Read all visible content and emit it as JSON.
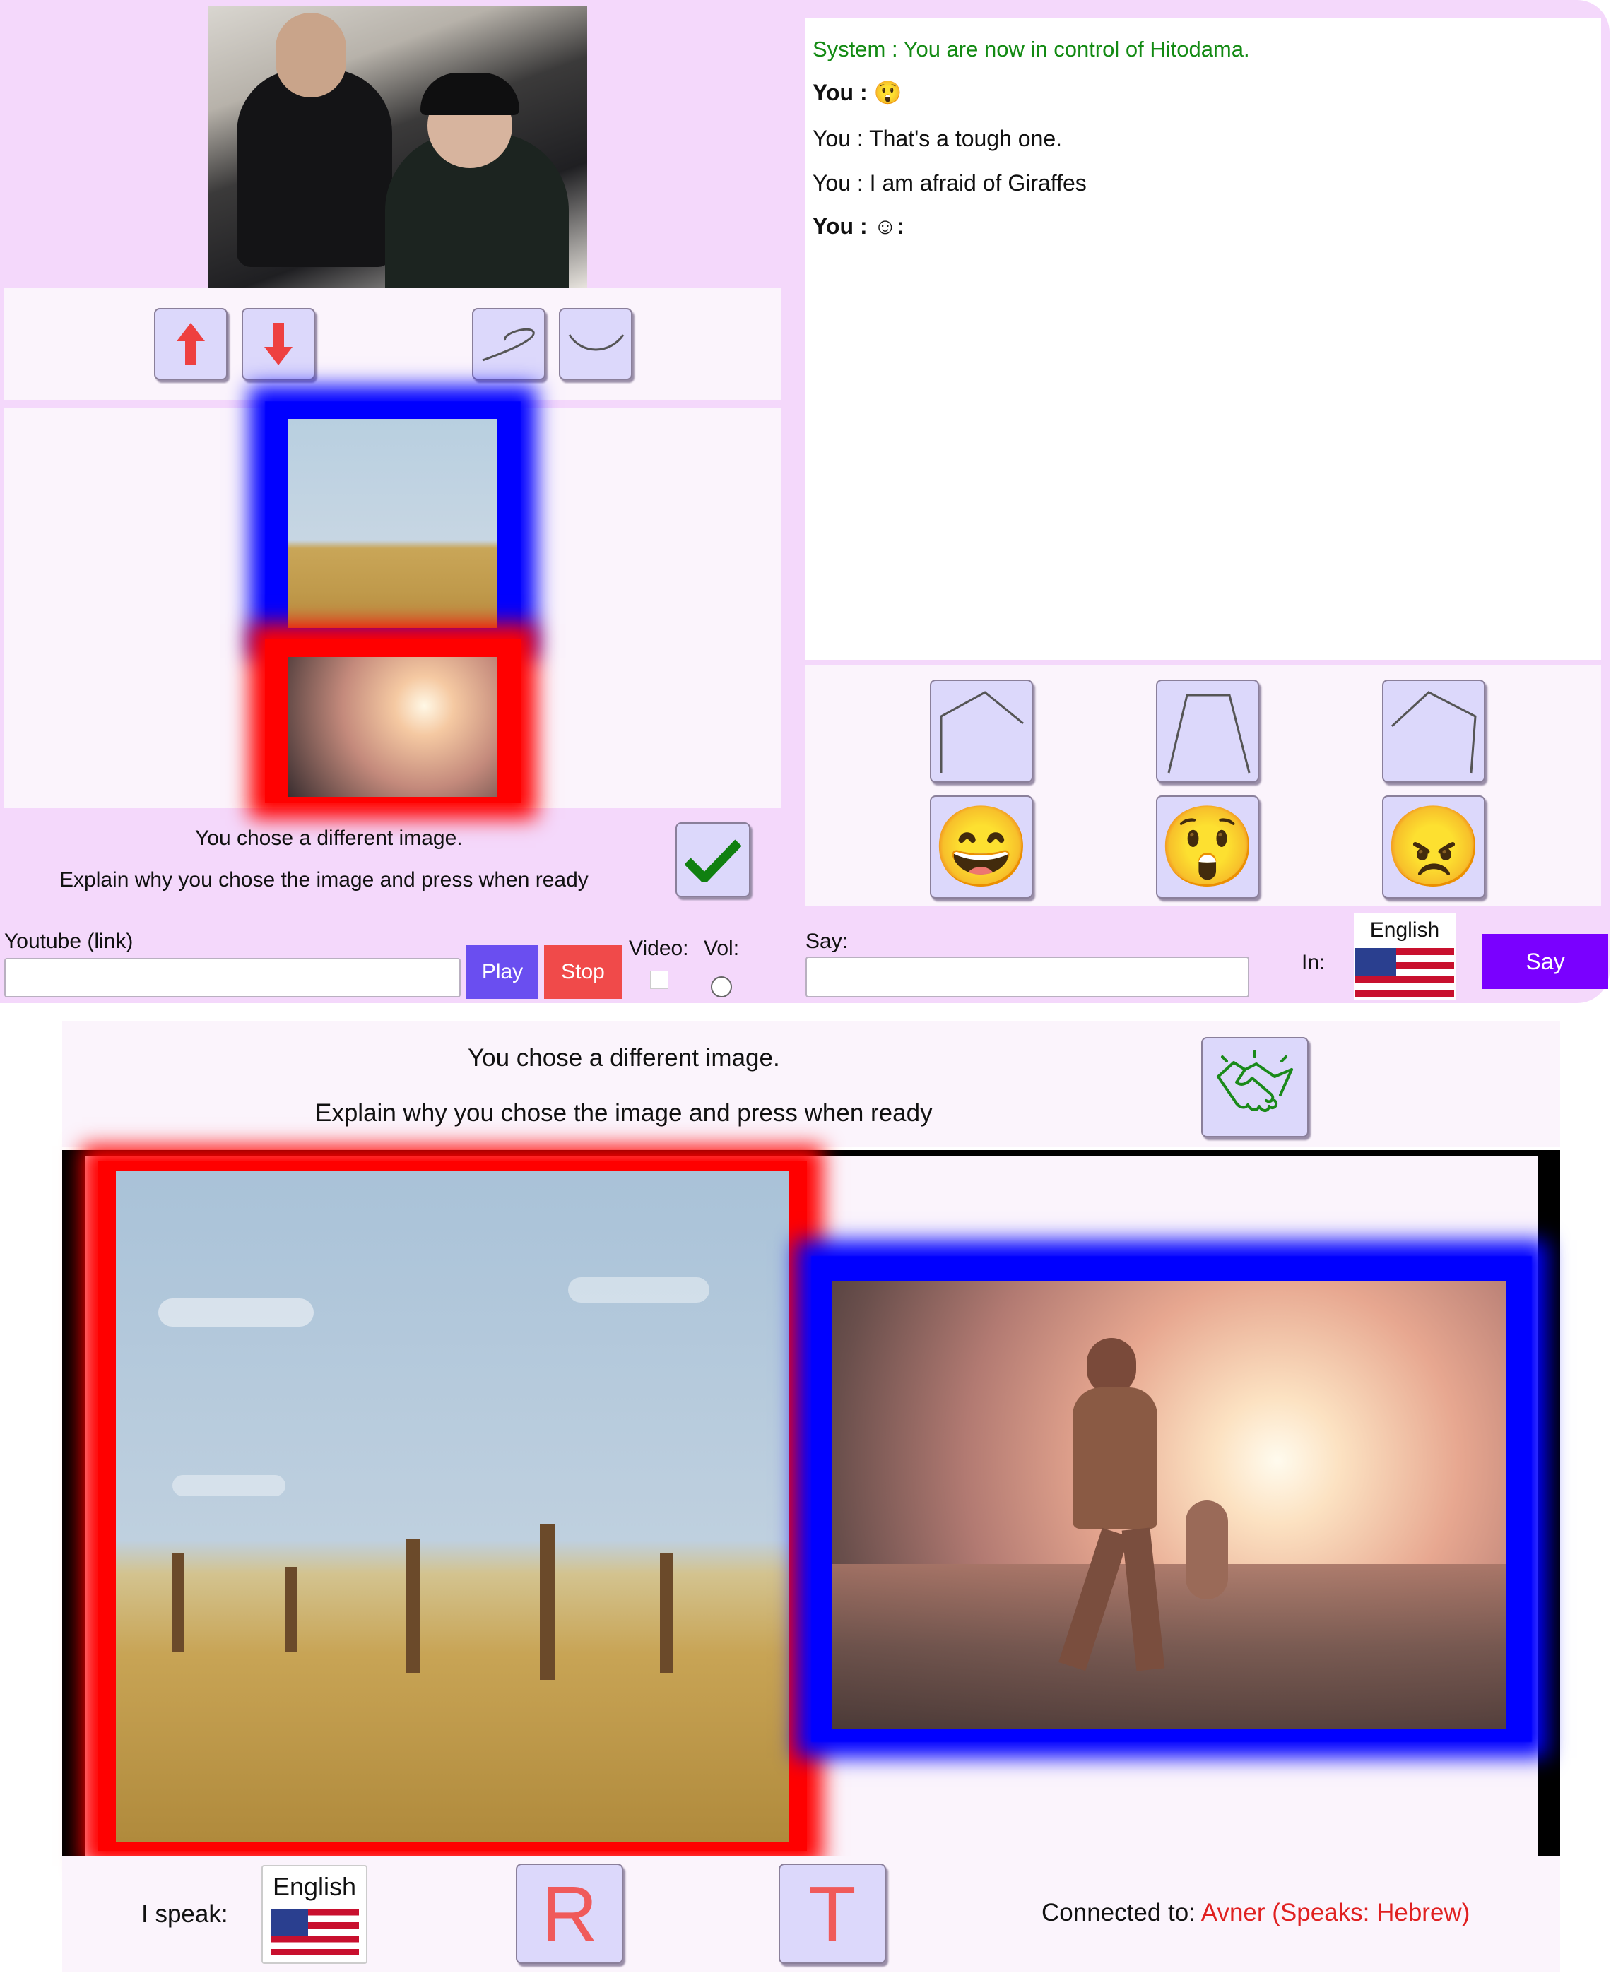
{
  "chat": {
    "system_line": "System : You are now in control of Hitodama.",
    "messages": [
      {
        "speaker": "You :",
        "text": "😲",
        "bold": true
      },
      {
        "speaker": "You :",
        "text": "That's a tough one.",
        "bold": false
      },
      {
        "speaker": "You :",
        "text": "I am afraid of Giraffes",
        "bold": false
      },
      {
        "speaker": "You :",
        "text": "☺:",
        "bold": true
      }
    ]
  },
  "left_panel": {
    "prompt_line1": "You chose a different image.",
    "prompt_line2": "Explain why you chose the image and press when ready",
    "controls": [
      "arrow-up-icon",
      "arrow-down-icon",
      "curve-s-icon",
      "curve-smile-icon"
    ]
  },
  "gesture_buttons": [
    "pentagon-shape-icon",
    "trapezoid-shape-icon",
    "pentagon-tilted-icon"
  ],
  "emoji_buttons": [
    "😄",
    "😲",
    "😠"
  ],
  "media_bar": {
    "youtube_label": "Youtube (link)",
    "play_label": "Play",
    "stop_label": "Stop",
    "video_label": "Video:",
    "vol_label": "Vol:",
    "say_label": "Say:",
    "in_label": "In:",
    "language": "English",
    "say_button": "Say"
  },
  "bottom": {
    "prompt_line1": "You chose a different image.",
    "prompt_line2": "Explain why you chose the image and press when ready",
    "i_speak_label": "I speak:",
    "language": "English",
    "r_button": "R",
    "t_button": "T",
    "connected_label": "Connected to:",
    "connected_value": "Avner (Speaks: Hebrew)"
  },
  "colors": {
    "panel_bg": "#f4d8fb",
    "system_text": "#138a13",
    "play": "#6a4ef0",
    "stop": "#f04a4a",
    "say": "#7a00ff",
    "connected_value": "#e02020"
  }
}
